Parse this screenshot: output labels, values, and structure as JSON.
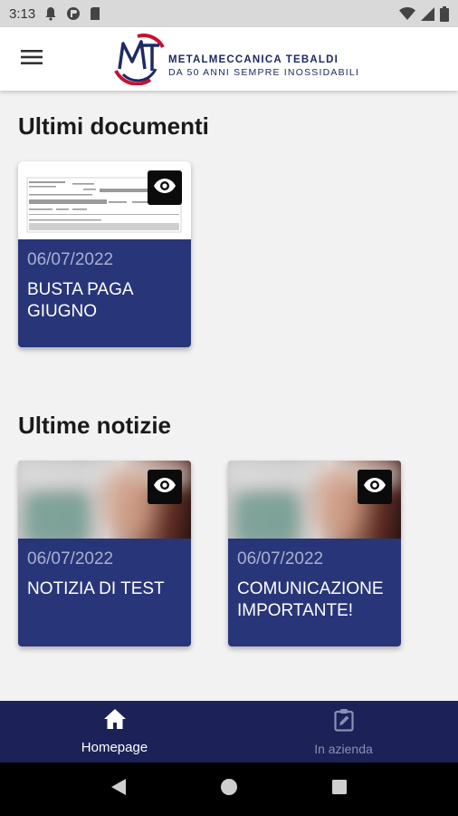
{
  "status_bar": {
    "time": "3:13",
    "icons": [
      "bell-icon",
      "cast-icon",
      "sd-card-icon",
      "wifi-icon",
      "signal-icon",
      "battery-icon"
    ]
  },
  "header": {
    "menu_icon": "hamburger-menu-icon",
    "brand_name": "METALMECCANICA TEBALDI",
    "brand_tagline": "DA 50 ANNI SEMPRE INOSSIDABILI",
    "logo_colors": {
      "navy": "#1d2a63",
      "red": "#c8102e"
    }
  },
  "sections": {
    "documents_title": "Ultimi documenti",
    "news_title": "Ultime notizie"
  },
  "documents": [
    {
      "date": "06/07/2022",
      "title": "BUSTA PAGA\nGIUGNO",
      "icon": "eye-icon"
    }
  ],
  "news": [
    {
      "date": "06/07/2022",
      "title": "NOTIZIA DI TEST",
      "icon": "eye-icon"
    },
    {
      "date": "06/07/2022",
      "title": "COMUNICAZIONE\nIMPORTANTE!",
      "icon": "eye-icon"
    }
  ],
  "bottom_nav": {
    "items": [
      {
        "label": "Homepage",
        "icon": "home-icon",
        "active": true
      },
      {
        "label": "In azienda",
        "icon": "clipboard-edit-icon",
        "active": false
      }
    ]
  },
  "system_nav": {
    "icons": [
      "back-icon",
      "home-circle-icon",
      "recents-icon"
    ]
  },
  "colors": {
    "card_blue": "#283579",
    "nav_bar": "#1c2257",
    "background": "#f2f2f2"
  }
}
